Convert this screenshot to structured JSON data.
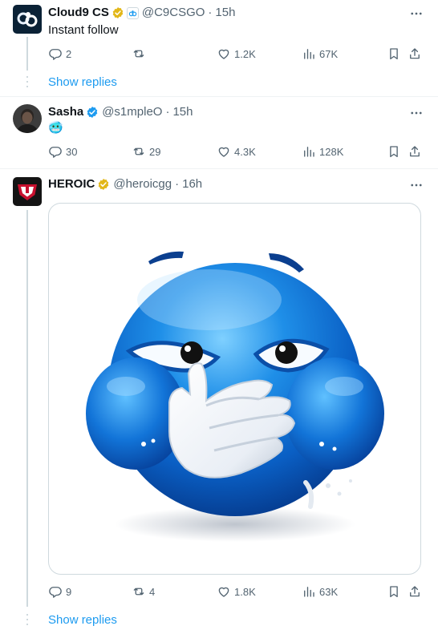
{
  "tweets": [
    {
      "name": "Cloud9 CS",
      "handle": "@C9CSGO",
      "time": "15h",
      "text": "Instant follow",
      "badge_color": "#e2b719",
      "stats": {
        "replies": "2",
        "reposts": "",
        "likes": "1.2K",
        "views": "67K"
      },
      "show_replies": "Show replies"
    },
    {
      "name": "Sasha",
      "handle": "@s1mpleO",
      "time": "15h",
      "text": "🥶",
      "badge_color": "#1d9bf0",
      "stats": {
        "replies": "30",
        "reposts": "29",
        "likes": "4.3K",
        "views": "128K"
      }
    },
    {
      "name": "HEROIC",
      "handle": "@heroicgg",
      "time": "16h",
      "badge_color": "#e2b719",
      "media": "blue laughing emoji covering mouth",
      "stats": {
        "replies": "9",
        "reposts": "4",
        "likes": "1.8K",
        "views": "63K"
      },
      "show_replies": "Show replies"
    }
  ],
  "separator": "·",
  "colors": {
    "accent": "#1d9bf0",
    "muted": "#536471",
    "text": "#0f1419",
    "line": "#cfd9de"
  },
  "icons": [
    "more-icon",
    "reply-icon",
    "repost-icon",
    "like-icon",
    "views-icon",
    "bookmark-icon",
    "share-icon",
    "verified-badge-icon"
  ]
}
